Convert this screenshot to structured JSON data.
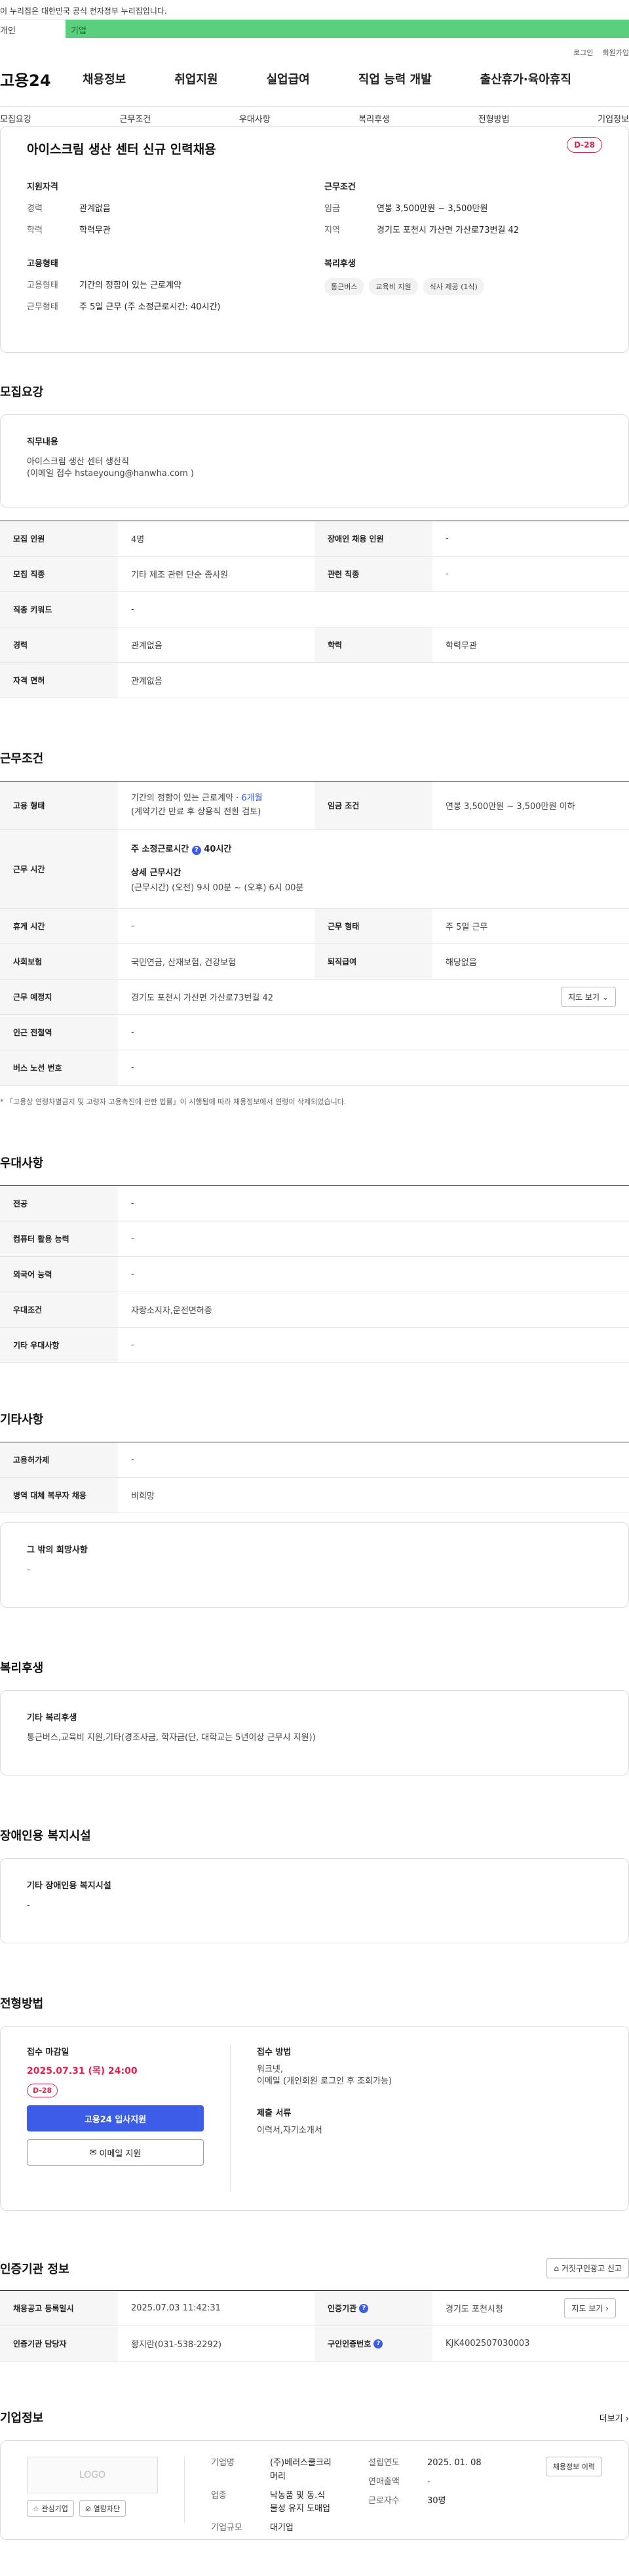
{
  "gov_banner": "이 누리집은 대한민국 공식 전자정부 누리집입니다.",
  "topbar": {
    "tab_personal": "개인",
    "tab_company": "기업"
  },
  "util": {
    "login": "로그인",
    "join": "회원가입"
  },
  "gnb": {
    "logo": "고용24",
    "items": [
      "채용정보",
      "취업지원",
      "실업급여",
      "직업 능력 개발",
      "출산휴가·육아휴직"
    ]
  },
  "subnav": [
    "모집요강",
    "근무조건",
    "우대사항",
    "복리후생",
    "전형방법",
    "기업정보"
  ],
  "hero": {
    "title": "아이스크림 생산 센터 신규 인력채용",
    "dday": "D-28",
    "qual_title": "지원자격",
    "career_k": "경력",
    "career_v": "관계없음",
    "edu_k": "학력",
    "edu_v": "학력무관",
    "cond_title": "근무조건",
    "wage_k": "임금",
    "wage_v": "연봉 3,500만원 ~ 3,500만원",
    "region_k": "지역",
    "region_v": "경기도 포천시 가산면 가산로73번길 42",
    "emp_title": "고용형태",
    "emptype_k": "고용형태",
    "emptype_v": "기간의 정함이 있는 근로계약",
    "workform_k": "근무형태",
    "workform_v": "주 5일 근무 (주 소정근로시간: 40시간)",
    "welfare_title": "복리후생",
    "chips": [
      "통근버스",
      "교육비 지원",
      "식사 제공 (1식)"
    ]
  },
  "recruit": {
    "heading": "모집요강",
    "duty_title": "직무내용",
    "duty_line1": "아이스크림 생산 센터 생산직",
    "duty_line2": "(이메일 접수 hstaeyoung@hanwha.com )",
    "rows": {
      "num_k": "모집 인원",
      "num_v": "4명",
      "dis_k": "장애인 채용 인원",
      "dis_v": "-",
      "job_k": "모집 직종",
      "job_v": "기타 제조 관련 단순 종사원",
      "rel_k": "관련 직종",
      "rel_v": "-",
      "kw_k": "직종 키워드",
      "kw_v": "-",
      "career_k": "경력",
      "career_v": "관계없음",
      "edu_k": "학력",
      "edu_v": "학력무관",
      "lic_k": "자격 면허",
      "lic_v": "관계없음"
    }
  },
  "work": {
    "heading": "근무조건",
    "emp_k": "고용 형태",
    "emp_v1": "기간의 정함이 있는 근로계약 · ",
    "emp_v1b": "6개월",
    "emp_v2": "(계약기간 만료 후 상용직 전환 검토)",
    "wage_k": "임금 조건",
    "wage_v": "연봉 3,500만원 ~ 3,500만원 이하",
    "time_k": "근무 시간",
    "time_v1": "주 소정근로시간",
    "time_v1b": "40시간",
    "time_v2": "상세 근무시간",
    "time_v3": "(근무시간) (오전) 9시 00분 ~ (오후) 6시 00분",
    "rest_k": "휴게 시간",
    "rest_v": "-",
    "form_k": "근무 형태",
    "form_v": "주 5일 근무",
    "ins_k": "사회보험",
    "ins_v": "국민연금, 산재보험, 건강보험",
    "ret_k": "퇴직급여",
    "ret_v": "해당없음",
    "place_k": "근무 예정지",
    "place_v": "경기도 포천시 가산면 가산로73번길 42",
    "map_btn": "지도 보기",
    "subway_k": "인근 전철역",
    "subway_v": "-",
    "bus_k": "버스 노선 번호",
    "bus_v": "-",
    "note": "* 「고용상 연령차별금지 및 고령자 고용촉진에 관한 법률」이 시행됨에 따라 채용정보에서 연령이 삭제되었습니다."
  },
  "pref": {
    "heading": "우대사항",
    "major_k": "전공",
    "major_v": "-",
    "pc_k": "컴퓨터 활용 능력",
    "pc_v": "-",
    "lang_k": "외국어 능력",
    "lang_v": "-",
    "cond_k": "우대조건",
    "cond_v": "자랑소지자,운전면허증",
    "etc_k": "기타 우대사항",
    "etc_v": "-"
  },
  "other": {
    "heading": "기타사항",
    "disab_k": "고용허가제",
    "disab_v": "-",
    "mil_k": "병역 대체 복무자 채용",
    "mil_v": "비희망",
    "wish_title": "그 밖의 희망사항",
    "wish_v": "-"
  },
  "welfare": {
    "heading": "복리후생",
    "title": "기타 복리후생",
    "text": "통근버스,교육비 지원,기타(경조사금, 학자금(단, 대학교는 5년이상 근무시 지원))"
  },
  "facility": {
    "heading": "장애인용 복지시설",
    "title": "기타 장애인용 복지시설",
    "text": "-"
  },
  "select": {
    "heading": "전형방법",
    "deadline_title": "접수 마감일",
    "deadline": "2025.07.31 (목) 24:00",
    "dday": "D-28",
    "apply_btn": "고용24 입사지원",
    "email_btn": "이메일 지원",
    "method_title": "접수 방법",
    "method_v1": "워크넷,",
    "method_v2": "이메일 (개인회원 로그인 후 조회가능)",
    "docs_title": "제출 서류",
    "docs_v": "이력서,자기소개서"
  },
  "agency": {
    "heading": "인증기관 정보",
    "report_btn": "거짓구인광고 신고",
    "reg_k": "채용공고 등록일시",
    "reg_v": "2025.07.03 11:42:31",
    "org_k": "인증기관",
    "org_v": "경기도 포천시청",
    "map_btn": "지도 보기",
    "mgr_k": "인증기관 담당자",
    "mgr_v": "황지란(031-538-2292)",
    "code_k": "구인인증번호",
    "code_v": "KJK4002507030003"
  },
  "company": {
    "heading": "기업정보",
    "more": "더보기",
    "logo_placeholder": "LOGO",
    "fav_btn": "관심기업",
    "block_btn": "열람차단",
    "name_k": "기업명",
    "name_v1": "(주)베러스쿨크리",
    "name_v2": "머리",
    "ind_k": "업종",
    "ind_v1": "낙농품 및 동.식",
    "ind_v2": "물성 유지 도매업",
    "size_k": "기업규모",
    "size_v": "대기업",
    "est_k": "설립연도",
    "est_v": "2025. 01. 08",
    "sales_k": "연매출액",
    "sales_v": "-",
    "emp_k": "근로자수",
    "emp_v": "30명",
    "history_btn": "채용정보 이력"
  },
  "colors": {
    "accent": "#3b5de7",
    "dday": "#e0234e",
    "green": "#5ad07f"
  }
}
